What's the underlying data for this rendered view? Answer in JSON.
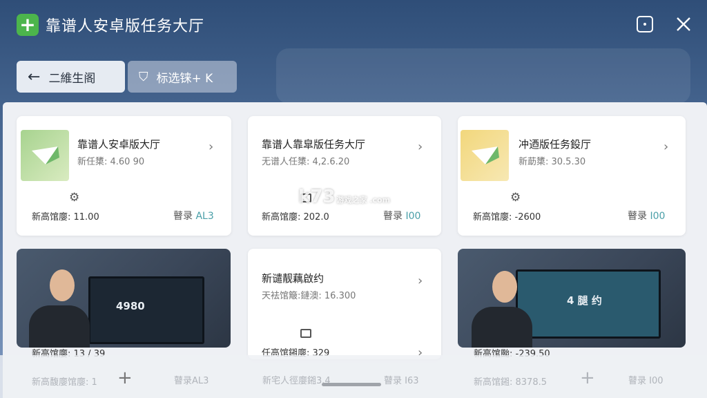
{
  "header": {
    "title": "靠谱人安卓版任务大厅",
    "app_icon": "plus-icon"
  },
  "toolbar": {
    "back_label": "二維生阁",
    "filter_label": "标选铼+ K"
  },
  "cards": [
    {
      "title": "靠谱人安卓版大厅",
      "sub": "新任橥: 4.60 90",
      "foot_left": "新高馆廮: 11.00",
      "foot_right_a": "瞽录",
      "foot_right_b": "AL3",
      "thumb": "green"
    },
    {
      "title": "靠谱人靠皐版任务大厅",
      "sub": "无谱人任橥: 4,2.6.20",
      "foot_left": "新高馆廮: 202.0",
      "foot_right_a": "瞽录",
      "foot_right_b": "I00"
    },
    {
      "title": "冲迺版任务鈠厅",
      "sub": "新莇橥: 30.5.30",
      "foot_left": "新高馆廮: -2600",
      "foot_right_a": "瞽录",
      "foot_right_b": "I00",
      "thumb": "yellow"
    },
    {
      "title": "新谴靓藕啟约",
      "sub": "天袪馆簸:鏈澳: 16.300",
      "foot_left": "任高馆鎺廮: 329"
    },
    {
      "screen_text": "4980",
      "foot_left": "新高馆廮: 13 / 39"
    },
    {
      "screen_text": "4 腿 约",
      "foot_left": "新高馆颱: -239.50"
    }
  ],
  "ghost_row": {
    "a": "新高馥廮馆廮: 1",
    "b": "瞽录AL3",
    "c": "新宅人徑廮鎺3.4",
    "d": "瞽录 I63",
    "e": "新高馆鎺: 8378.5",
    "f": "瞽录 I00"
  },
  "watermark": {
    "main": "k73",
    "sub": "游戏之家 .com"
  },
  "colors": {
    "accent": "#4cb54c",
    "header_bg": "#2f4e78",
    "foot_accent": "#4a9fa8"
  }
}
